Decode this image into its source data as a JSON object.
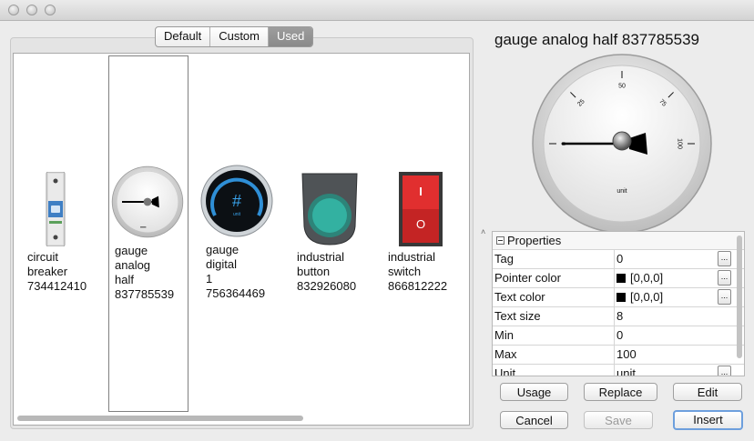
{
  "tabs": [
    "Default",
    "Custom",
    "Used"
  ],
  "selected_tab": "Used",
  "symbols": [
    {
      "label": [
        "circuit",
        "breaker",
        "734412410"
      ]
    },
    {
      "label": [
        "gauge",
        "analog",
        "half",
        "837785539"
      ]
    },
    {
      "label": [
        "gauge",
        "digital",
        "1",
        "756364469"
      ]
    },
    {
      "label": [
        "industrial",
        "button",
        "832926080"
      ]
    },
    {
      "label": [
        "industrial",
        "switch",
        "866812222"
      ]
    }
  ],
  "selected_symbol": "gauge analog half 837785539",
  "preview": {
    "title": "gauge analog half 837785539",
    "gauge_ticks": [
      "0",
      "25",
      "50",
      "75",
      "100"
    ],
    "gauge_unit": "unit",
    "pointer_value": 0
  },
  "digital_gauge": {
    "glyph": "#",
    "sub": "unit"
  },
  "switch_glyphs": {
    "on": "I",
    "off": "O"
  },
  "properties": {
    "header": "Properties",
    "rows": [
      {
        "name": "Tag",
        "value": "0",
        "ellipsis": "..."
      },
      {
        "name": "Pointer color",
        "value": "[0,0,0]",
        "swatch": "#000000",
        "ellipsis": "..."
      },
      {
        "name": "Text color",
        "value": "[0,0,0]",
        "swatch": "#000000",
        "ellipsis": "..."
      },
      {
        "name": "Text size",
        "value": "8"
      },
      {
        "name": "Min",
        "value": "0"
      },
      {
        "name": "Max",
        "value": "100"
      },
      {
        "name": "Unit",
        "value": "unit",
        "ellipsis": "..."
      }
    ]
  },
  "buttons": {
    "usage": "Usage",
    "replace": "Replace",
    "edit": "Edit",
    "cancel": "Cancel",
    "save": "Save",
    "insert": "Insert"
  },
  "splitter_glyph": "˄"
}
